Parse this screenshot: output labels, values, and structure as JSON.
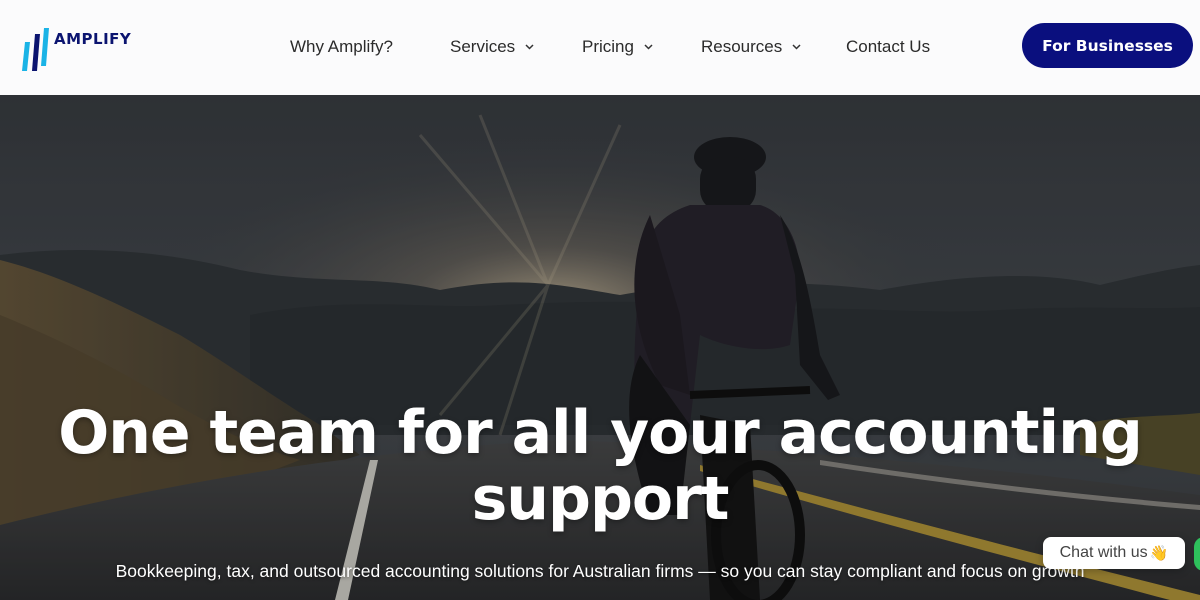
{
  "brand": {
    "name": "AMPLIFY",
    "logo_icon": "amplify-bars-logo",
    "accent": "#0a0f7e",
    "logo_cyan": "#1ab3e6"
  },
  "nav": {
    "items": [
      {
        "label": "Why Amplify?",
        "has_dropdown": false
      },
      {
        "label": "Services",
        "has_dropdown": true
      },
      {
        "label": "Pricing",
        "has_dropdown": true
      },
      {
        "label": "Resources",
        "has_dropdown": true
      },
      {
        "label": "Contact Us",
        "has_dropdown": false
      }
    ],
    "cta_label": "For Businesses"
  },
  "hero": {
    "title": "One team for all your accounting support",
    "subtitle": "Bookkeeping, tax, and outsourced accounting solutions for Australian firms — so you can stay compliant and focus on growth",
    "background": "cyclist-on-mountain-road-at-sunrise"
  },
  "chat": {
    "label": "Chat with us",
    "emoji": "👋",
    "status_color": "#2ec15c"
  }
}
